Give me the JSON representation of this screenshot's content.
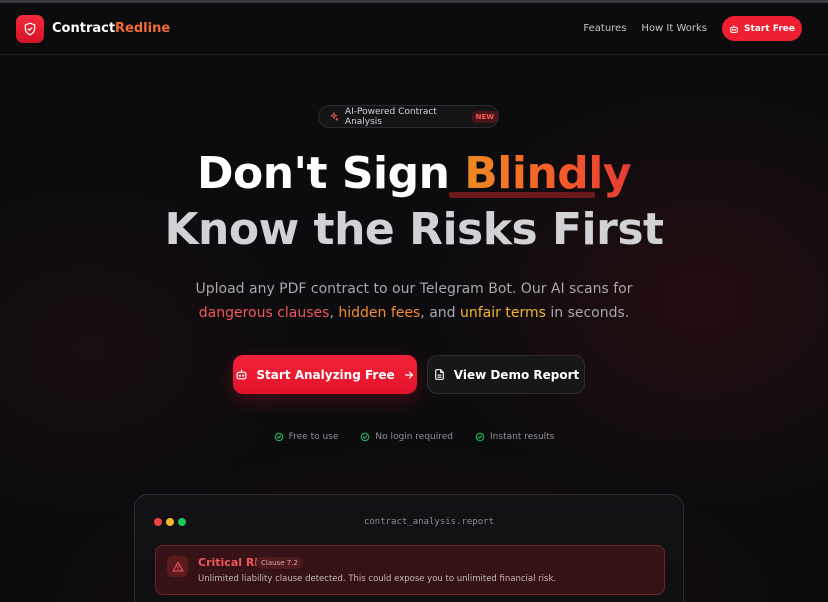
{
  "nav": {
    "brand_part1": "Contract",
    "brand_part2": "Redline",
    "links": [
      "Features",
      "How It Works"
    ],
    "cta": "Start Free"
  },
  "badge": {
    "text": "AI-Powered Contract Analysis",
    "tag": "NEW"
  },
  "hero": {
    "line1_plain": "Don't Sign ",
    "line1_accent": "Blindly",
    "line2": "Know the Risks First",
    "sub_line1": "Upload any PDF contract to our Telegram Bot. Our AI scans for",
    "kw1": "dangerous clauses",
    "sep1": ", ",
    "kw2": "hidden fees",
    "sep2": ", and ",
    "kw3": "unfair terms",
    "tail": " in seconds."
  },
  "cta": {
    "primary": "Start Analyzing Free",
    "secondary": "View Demo Report"
  },
  "features": [
    "Free to use",
    "No login required",
    "Instant results"
  ],
  "report": {
    "filename": "contract_analysis.report",
    "alert_title": "Critical Risk",
    "alert_tag": "Clause 7.2",
    "alert_desc": "Unlimited liability clause detected. This could expose you to unlimited financial risk."
  },
  "colors": {
    "accent_red": "#ee1f31",
    "accent_orange": "#f26a36",
    "success_green": "#22c55e",
    "window_red": "#ef4444",
    "window_yellow": "#f5b82e",
    "window_green": "#22c55e"
  },
  "icons": {
    "logo": "shield-icon",
    "badge": "sparkles-icon",
    "start": "bot-icon",
    "arrow": "arrow-right-icon",
    "demo": "document-icon",
    "feature": "check-circle-icon",
    "alert": "warning-triangle-icon"
  }
}
